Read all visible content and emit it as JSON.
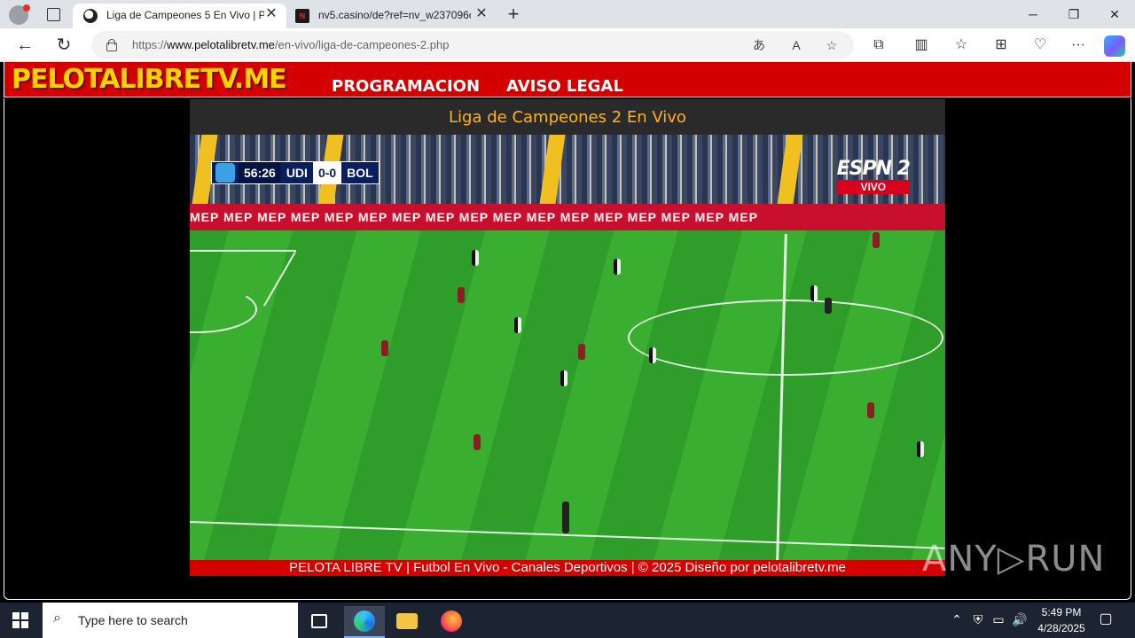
{
  "browser": {
    "tabs": [
      {
        "title": "Liga de Campeones 5 En Vivo | P",
        "active": true
      },
      {
        "title": "nv5.casino/de?ref=nv_w237096c",
        "active": false
      }
    ],
    "url_prefix": "https://",
    "url_domain": "www.pelotalibretv.me",
    "url_path": "/en-vivo/liga-de-campeones-2.php"
  },
  "site": {
    "logo": "PELOTALIBRETV.ME",
    "menu": [
      "PROGRAMACION",
      "AVISO LEGAL"
    ],
    "player_title": "Liga de Campeones 2 En Vivo",
    "footer": "PELOTA LIBRE TV | Futbol En Vivo - Canales Deportivos | © 2025 Diseño por pelotalibretv.me"
  },
  "stream": {
    "clock": "56:26",
    "home": "UDI",
    "score": "0-0",
    "away": "BOL",
    "channel": "ESPN 2",
    "live_label": "VIVO",
    "adboard": "MEP   MEP   MEP   MEP   MEP   MEP   MEP   MEP   MEP   MEP   MEP   MEP   MEP   MEP   MEP   MEP   MEP"
  },
  "watermark": "ANY▷RUN",
  "taskbar": {
    "search_placeholder": "Type here to search",
    "time": "5:49 PM",
    "date": "4/28/2025"
  },
  "colors": {
    "site_red": "#d40000",
    "logo_yellow": "#ffd200",
    "title_orange": "#ffb31a",
    "taskbar": "#1c2431"
  }
}
